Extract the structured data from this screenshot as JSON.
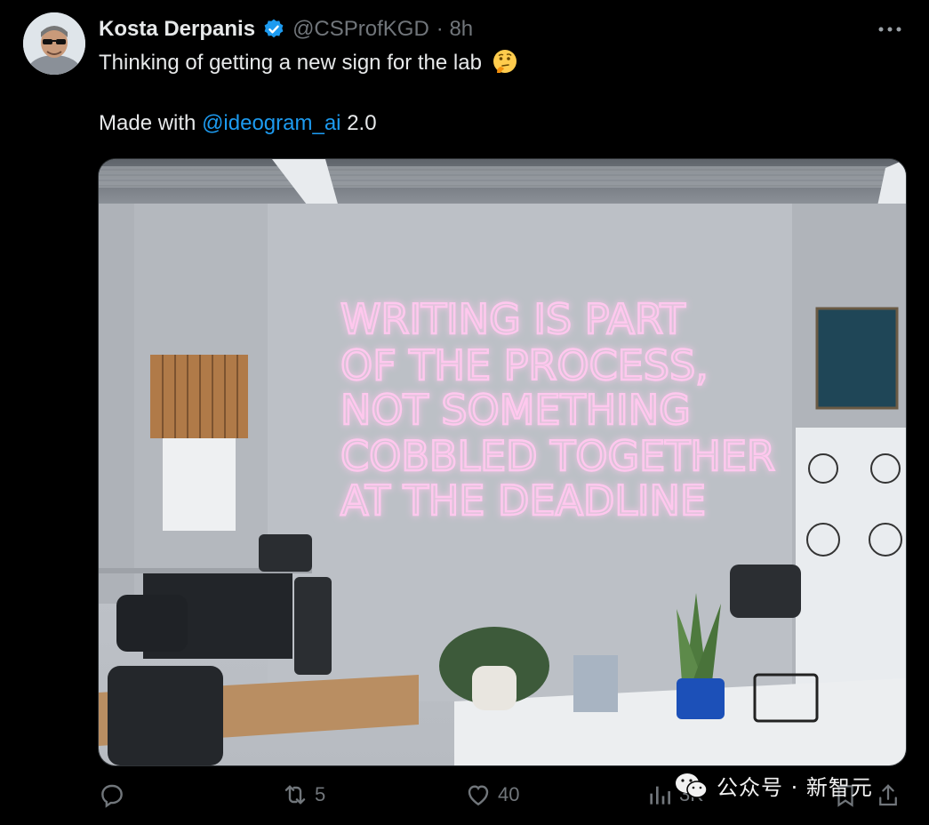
{
  "tweet": {
    "author_name": "Kosta Derpanis",
    "handle": "@CSProfKGD",
    "time": "· 8h",
    "text_line1": "Thinking of getting a new sign for the lab",
    "made_with_prefix": "Made with",
    "mention": "@ideogram_ai",
    "made_with_suffix": "2.0"
  },
  "image": {
    "sign_lines": [
      "WRITING IS PART",
      "OF THE PROCESS,",
      "NOT SOMETHING",
      "COBBLED TOGETHER",
      "AT THE DEADLINE"
    ]
  },
  "actions": {
    "reply_count": "",
    "retweet_count": "5",
    "like_count": "40",
    "views_count": "3K"
  },
  "watermark": {
    "text": "公众号 · 新智元"
  },
  "icons": [
    "avatar",
    "verified-icon",
    "more-icon",
    "thinking-emoji-icon",
    "reply-icon",
    "retweet-icon",
    "like-icon",
    "views-icon",
    "bookmark-icon",
    "share-icon",
    "wechat-icon"
  ],
  "colors": {
    "background": "#000000",
    "text": "#e7e9ea",
    "muted": "#71767b",
    "accent": "#1d9bf0",
    "neon": "#ffc8ee"
  }
}
